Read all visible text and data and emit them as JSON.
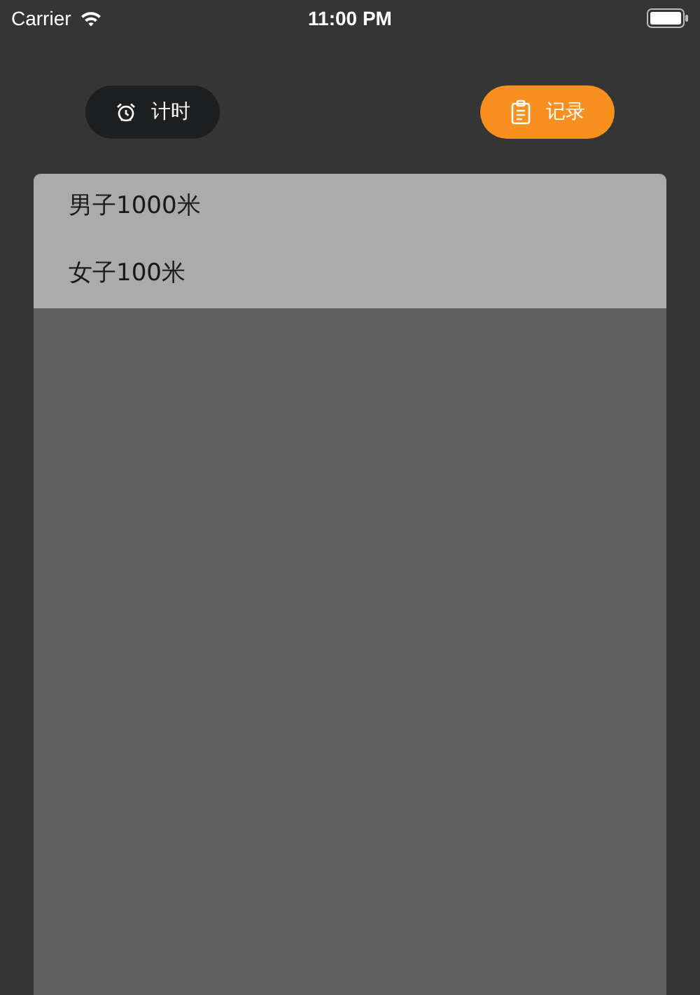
{
  "status_bar": {
    "carrier": "Carrier",
    "time": "11:00 PM"
  },
  "tabs": [
    {
      "label": "计时",
      "selected": false
    },
    {
      "label": "记录",
      "selected": true
    }
  ],
  "records": [
    {
      "label": "男子1000米"
    },
    {
      "label": "女子100米"
    }
  ]
}
